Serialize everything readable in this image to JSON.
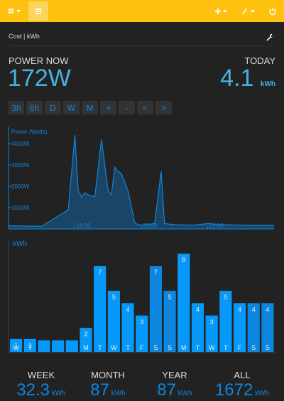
{
  "toolbar": {
    "apps_icon": "grid-icon",
    "list_icon": "list-icon",
    "add_icon": "plus-icon",
    "setup_icon": "wrench-icon",
    "power_icon": "power-icon",
    "bar_color": "#fec10f"
  },
  "header": {
    "title": "Cost | kWh",
    "settings_icon": "wrench-icon"
  },
  "power_now": {
    "label": "POWER NOW",
    "value": "172W"
  },
  "today": {
    "label": "TODAY",
    "value": "4.1",
    "unit": "kWh"
  },
  "range_buttons": [
    "3h",
    "6h",
    "D",
    "W",
    "M",
    "+",
    "-",
    "<",
    ">"
  ],
  "chart_data": [
    {
      "type": "area",
      "ylabel": "Power (Watts)",
      "y_ticks": [
        "1000W",
        "2000W",
        "3000W",
        "4000W"
      ],
      "x_ticks": [
        "19:00",
        "20:00",
        "21:00"
      ],
      "ylim": [
        0,
        4800
      ],
      "x_hours": [
        18.0,
        18.5,
        18.9,
        19.0,
        19.05,
        19.1,
        19.15,
        19.2,
        19.3,
        19.4,
        19.5,
        19.55,
        19.6,
        19.65,
        19.7,
        19.8,
        19.9,
        19.95,
        20.0,
        20.2,
        20.3,
        20.35,
        20.5,
        20.8,
        21.0,
        21.2,
        21.5,
        21.8,
        22.0
      ],
      "values": [
        150,
        120,
        900,
        4400,
        1800,
        1500,
        1700,
        1600,
        1500,
        4200,
        1800,
        1600,
        2900,
        2700,
        2600,
        1800,
        300,
        200,
        180,
        250,
        2700,
        250,
        200,
        180,
        250,
        200,
        180,
        170,
        172
      ],
      "color": "#0d86e0"
    },
    {
      "type": "bar",
      "ylabel": "kWh",
      "categories": [
        "W",
        "T",
        "F",
        "S",
        "S",
        "M",
        "T",
        "W",
        "T",
        "F",
        "S",
        "S",
        "M",
        "T",
        "W",
        "T",
        "F",
        "S",
        "S"
      ],
      "values": [
        1.1,
        1.1,
        1.0,
        1.0,
        1.0,
        2.0,
        7.0,
        5.0,
        4.0,
        3.0,
        7.0,
        5.0,
        8.0,
        4.0,
        3.0,
        5.0,
        4.0,
        4.0,
        4.0
      ],
      "labels": [
        "1",
        "1",
        "",
        "",
        "",
        "2",
        "7",
        "5",
        "4",
        "3",
        "7",
        "5",
        "8",
        "4",
        "3",
        "5",
        "4",
        "4",
        "4"
      ],
      "day_labels": [
        "W",
        "T",
        "",
        "",
        "",
        "M",
        "T",
        "W",
        "T",
        "F",
        "S",
        "S",
        "M",
        "T",
        "W",
        "T",
        "F",
        "S",
        "S"
      ],
      "ylim": [
        0,
        8.5
      ],
      "color": "#0699fa",
      "alt_color": "#0d86e0"
    }
  ],
  "footer": [
    {
      "label": "WEEK",
      "value": "32.3",
      "unit": "kWh"
    },
    {
      "label": "MONTH",
      "value": "87",
      "unit": "kWh"
    },
    {
      "label": "YEAR",
      "value": "87",
      "unit": "kWh"
    },
    {
      "label": "ALL",
      "value": "1672",
      "unit": "kWh"
    }
  ]
}
